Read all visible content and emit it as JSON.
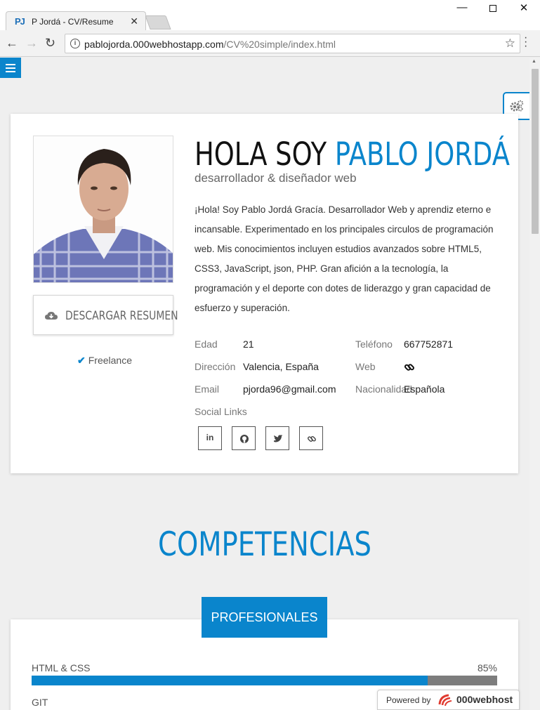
{
  "browser": {
    "tab_title": "P Jordá - CV/Resume",
    "tab_favicon": "PJ",
    "url_host": "pablojorda.000webhostapp.com",
    "url_path": "/CV%20simple/index.html"
  },
  "profile": {
    "greeting": "HOLA SOY",
    "name": "PABLO JORDÁ",
    "subtitle": "desarrollador & diseñador web",
    "bio": "¡Hola! Soy Pablo Jordá Gracía. Desarrollador Web y aprendiz eterno e incansable. Experimentado en los principales circulos de programación web. Mis conocimientos incluyen estudios avanzados sobre HTML5, CSS3, JavaScript, json, PHP. Gran afición a la tecnología, la programación y el deporte con dotes de liderazgo y gran capacidad de esfuerzo y superación.",
    "download_label": "DESCARGAR RESUMEN",
    "freelance": "Freelance",
    "info": {
      "edad_label": "Edad",
      "edad_value": "21",
      "direccion_label": "Dirección",
      "direccion_value": "Valencia, España",
      "email_label": "Email",
      "email_value": "pjorda96@gmail.com",
      "telefono_label": "Teléfono",
      "telefono_value": "667752871",
      "web_label": "Web",
      "nacionalidad_label": "Nacionalidad",
      "nacionalidad_value": "Española",
      "social_label": "Social Links"
    },
    "social": {
      "linkedin_label": "in"
    }
  },
  "skills": {
    "section_title": "COMPETENCIAS",
    "tab_label": "PROFESIONALES",
    "items": [
      {
        "name": "HTML & CSS",
        "percent": 85,
        "percent_label": "85%"
      },
      {
        "name": "GIT"
      }
    ]
  },
  "footer": {
    "powered_by": "Powered by",
    "host_brand": "000webhost"
  },
  "colors": {
    "accent": "#0a85cc",
    "track": "#7d7d7d"
  }
}
